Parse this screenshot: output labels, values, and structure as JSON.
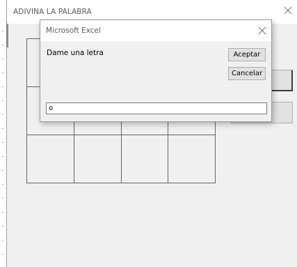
{
  "userform": {
    "title": "ADIVINA LA PALABRA",
    "close_icon": "close-icon",
    "grid": {
      "rows": 3,
      "columns": 4
    },
    "buttons": [
      {
        "label": ""
      },
      {
        "label": ""
      }
    ]
  },
  "inputbox": {
    "title": "Microsoft Excel",
    "prompt": "Dame una letra",
    "ok_label": "Aceptar",
    "cancel_label": "Cancelar",
    "input_value": "o",
    "close_icon": "close-icon"
  }
}
